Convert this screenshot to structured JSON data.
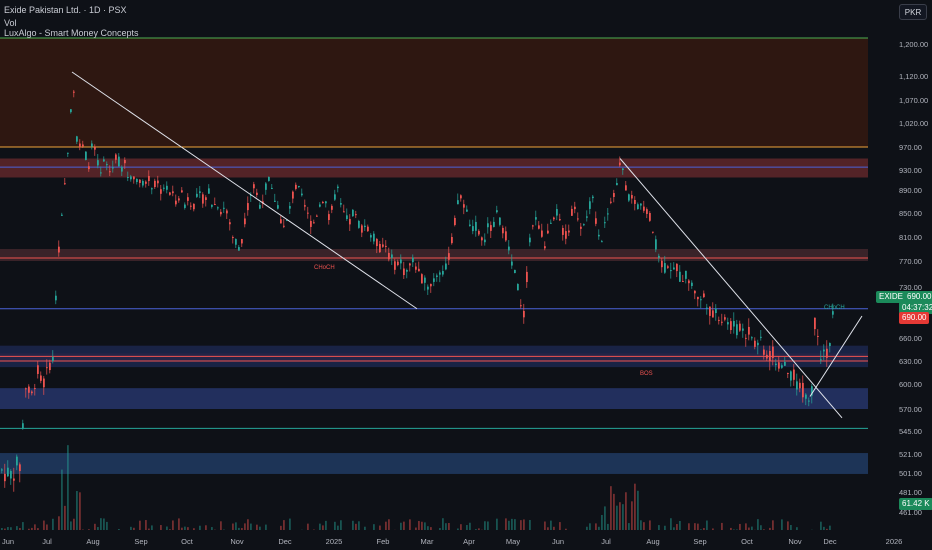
{
  "header": {
    "title": "Exide Pakistan Ltd. · 1D · PSX",
    "volume_label": "Vol",
    "indicator_label": "LuxAlgo - Smart Money Concepts"
  },
  "currency_button": "PKR",
  "price_badges": {
    "ticker": "EXIDE",
    "last_price": "690.00",
    "countdown": "04:37:32",
    "close_price": "690.00",
    "volume": "61.42 K"
  },
  "colors": {
    "background": "#0e1117",
    "up": "#26a69a",
    "down": "#ef5350",
    "trendline": "#e0e3eb",
    "resistance_line": "#f0a43a",
    "blue_line": "#4a62d8",
    "badge_green": "#1b8a5a",
    "badge_red": "#e53935"
  },
  "chart_data": {
    "type": "candlestick",
    "symbol": "EXIDE",
    "exchange": "PSX",
    "interval": "1D",
    "currency": "PKR",
    "price_axis": {
      "ylim": [
        452,
        1240
      ],
      "tick_labels": [
        "1,200.00",
        "1,120.00",
        "1,070.00",
        "1,020.00",
        "970.00",
        "930.00",
        "890.00",
        "850.00",
        "810.00",
        "770.00",
        "730.00",
        "690.00",
        "660.00",
        "630.00",
        "600.00",
        "570.00",
        "545.00",
        "521.00",
        "501.00",
        "481.00",
        "461.00"
      ]
    },
    "time_axis": {
      "tick_labels": [
        "Jun",
        "Jul",
        "Aug",
        "Sep",
        "Oct",
        "Nov",
        "Dec",
        "2025",
        "Feb",
        "Mar",
        "Apr",
        "May",
        "Jun",
        "Jul",
        "Aug",
        "Sep",
        "Oct",
        "Nov",
        "Dec",
        "2026"
      ]
    },
    "price_path": [
      [
        0,
        505
      ],
      [
        4,
        500
      ],
      [
        8,
        502
      ],
      [
        12,
        498
      ],
      [
        16,
        510
      ],
      [
        20,
        506
      ],
      [
        24,
        600
      ],
      [
        28,
        590
      ],
      [
        32,
        585
      ],
      [
        36,
        620
      ],
      [
        40,
        605
      ],
      [
        44,
        602
      ],
      [
        48,
        625
      ],
      [
        52,
        632
      ],
      [
        56,
        750
      ],
      [
        60,
        820
      ],
      [
        64,
        900
      ],
      [
        68,
        990
      ],
      [
        70,
        1050
      ],
      [
        72,
        1120
      ],
      [
        74,
        1060
      ],
      [
        76,
        990
      ],
      [
        80,
        975
      ],
      [
        84,
        960
      ],
      [
        88,
        940
      ],
      [
        92,
        980
      ],
      [
        96,
        945
      ],
      [
        100,
        920
      ],
      [
        104,
        950
      ],
      [
        108,
        925
      ],
      [
        112,
        935
      ],
      [
        116,
        960
      ],
      [
        120,
        930
      ],
      [
        124,
        940
      ],
      [
        128,
        910
      ],
      [
        132,
        925
      ],
      [
        136,
        905
      ],
      [
        140,
        915
      ],
      [
        144,
        900
      ],
      [
        148,
        910
      ],
      [
        152,
        895
      ],
      [
        156,
        905
      ],
      [
        160,
        890
      ],
      [
        164,
        900
      ],
      [
        168,
        885
      ],
      [
        172,
        880
      ],
      [
        176,
        870
      ],
      [
        180,
        890
      ],
      [
        184,
        865
      ],
      [
        188,
        880
      ],
      [
        192,
        860
      ],
      [
        196,
        875
      ],
      [
        200,
        880
      ],
      [
        204,
        870
      ],
      [
        208,
        890
      ],
      [
        212,
        860
      ],
      [
        216,
        870
      ],
      [
        220,
        855
      ],
      [
        224,
        860
      ],
      [
        228,
        840
      ],
      [
        232,
        810
      ],
      [
        236,
        800
      ],
      [
        240,
        790
      ],
      [
        244,
        840
      ],
      [
        248,
        870
      ],
      [
        252,
        900
      ],
      [
        256,
        880
      ],
      [
        260,
        860
      ],
      [
        264,
        890
      ],
      [
        268,
        910
      ],
      [
        272,
        880
      ],
      [
        276,
        870
      ],
      [
        280,
        840
      ],
      [
        284,
        820
      ],
      [
        288,
        850
      ],
      [
        292,
        880
      ],
      [
        296,
        900
      ],
      [
        300,
        880
      ],
      [
        304,
        860
      ],
      [
        308,
        840
      ],
      [
        312,
        830
      ],
      [
        316,
        850
      ],
      [
        320,
        870
      ],
      [
        324,
        880
      ],
      [
        328,
        840
      ],
      [
        332,
        860
      ],
      [
        336,
        900
      ],
      [
        340,
        860
      ],
      [
        344,
        845
      ],
      [
        348,
        830
      ],
      [
        352,
        850
      ],
      [
        356,
        840
      ],
      [
        360,
        825
      ],
      [
        364,
        830
      ],
      [
        368,
        820
      ],
      [
        372,
        810
      ],
      [
        376,
        800
      ],
      [
        380,
        790
      ],
      [
        384,
        800
      ],
      [
        388,
        780
      ],
      [
        392,
        770
      ],
      [
        396,
        760
      ],
      [
        400,
        770
      ],
      [
        404,
        750
      ],
      [
        408,
        760
      ],
      [
        412,
        770
      ],
      [
        416,
        760
      ],
      [
        420,
        740
      ],
      [
        424,
        745
      ],
      [
        428,
        730
      ],
      [
        432,
        740
      ],
      [
        436,
        750
      ],
      [
        440,
        760
      ],
      [
        444,
        750
      ],
      [
        448,
        780
      ],
      [
        452,
        810
      ],
      [
        456,
        860
      ],
      [
        460,
        880
      ],
      [
        464,
        860
      ],
      [
        468,
        840
      ],
      [
        472,
        820
      ],
      [
        476,
        830
      ],
      [
        480,
        800
      ],
      [
        484,
        810
      ],
      [
        488,
        830
      ],
      [
        492,
        820
      ],
      [
        496,
        850
      ],
      [
        500,
        830
      ],
      [
        504,
        820
      ],
      [
        508,
        790
      ],
      [
        512,
        760
      ],
      [
        516,
        740
      ],
      [
        520,
        700
      ],
      [
        524,
        690
      ],
      [
        528,
        800
      ],
      [
        532,
        830
      ],
      [
        536,
        840
      ],
      [
        540,
        820
      ],
      [
        544,
        800
      ],
      [
        548,
        820
      ],
      [
        552,
        830
      ],
      [
        556,
        850
      ],
      [
        560,
        830
      ],
      [
        564,
        810
      ],
      [
        568,
        820
      ],
      [
        572,
        860
      ],
      [
        576,
        850
      ],
      [
        580,
        830
      ],
      [
        584,
        840
      ],
      [
        588,
        860
      ],
      [
        592,
        870
      ],
      [
        596,
        820
      ],
      [
        600,
        800
      ],
      [
        604,
        840
      ],
      [
        608,
        860
      ],
      [
        612,
        880
      ],
      [
        616,
        900
      ],
      [
        620,
        950
      ],
      [
        624,
        900
      ],
      [
        628,
        880
      ],
      [
        632,
        870
      ],
      [
        636,
        860
      ],
      [
        640,
        870
      ],
      [
        644,
        860
      ],
      [
        648,
        850
      ],
      [
        652,
        820
      ],
      [
        656,
        790
      ],
      [
        660,
        770
      ],
      [
        664,
        760
      ],
      [
        668,
        770
      ],
      [
        672,
        750
      ],
      [
        676,
        760
      ],
      [
        680,
        740
      ],
      [
        684,
        750
      ],
      [
        688,
        740
      ],
      [
        692,
        730
      ],
      [
        696,
        720
      ],
      [
        700,
        710
      ],
      [
        704,
        720
      ],
      [
        708,
        700
      ],
      [
        712,
        690
      ],
      [
        716,
        700
      ],
      [
        720,
        685
      ],
      [
        724,
        690
      ],
      [
        728,
        675
      ],
      [
        732,
        680
      ],
      [
        736,
        670
      ],
      [
        740,
        680
      ],
      [
        744,
        665
      ],
      [
        748,
        670
      ],
      [
        752,
        660
      ],
      [
        756,
        650
      ],
      [
        760,
        660
      ],
      [
        764,
        640
      ],
      [
        768,
        635
      ],
      [
        772,
        640
      ],
      [
        776,
        625
      ],
      [
        780,
        630
      ],
      [
        784,
        620
      ],
      [
        788,
        610
      ],
      [
        792,
        615
      ],
      [
        796,
        600
      ],
      [
        800,
        595
      ],
      [
        804,
        590
      ],
      [
        808,
        580
      ],
      [
        812,
        600
      ],
      [
        814,
        680
      ],
      [
        816,
        690
      ],
      [
        818,
        650
      ],
      [
        820,
        640
      ],
      [
        822,
        660
      ],
      [
        824,
        630
      ],
      [
        826,
        640
      ],
      [
        828,
        650
      ],
      [
        830,
        660
      ],
      [
        832,
        690
      ]
    ],
    "horizontal_levels": [
      {
        "price": 1215,
        "color": "#4caf50"
      },
      {
        "price": 970,
        "color": "#f0a43a"
      },
      {
        "price": 935,
        "color": "#4a62d8"
      },
      {
        "price": 775,
        "color": "#ef5350"
      },
      {
        "price": 700,
        "color": "#4a62d8"
      },
      {
        "price": 636,
        "color": "#ef5350"
      },
      {
        "price": 630,
        "color": "#ef5350"
      },
      {
        "price": 548,
        "color": "#26a69a"
      }
    ],
    "zones": [
      {
        "from": 1215,
        "to": 970,
        "color": "#3a1a10"
      },
      {
        "from": 950,
        "to": 915,
        "color": "#6b2a2e"
      },
      {
        "from": 790,
        "to": 770,
        "color": "#4a2a30"
      },
      {
        "from": 640,
        "to": 630,
        "color": "#4a1d22"
      },
      {
        "from": 650,
        "to": 622,
        "color": "#1d2a55"
      },
      {
        "from": 595,
        "to": 570,
        "color": "#2a3a75"
      },
      {
        "from": 522,
        "to": 500,
        "color": "#23406e"
      }
    ],
    "labels": [
      {
        "text": "BOS",
        "x": 640,
        "price": 612,
        "color": "#ef5350"
      },
      {
        "text": "CHoCH",
        "x": 314,
        "price": 758,
        "color": "#ef5350"
      },
      {
        "text": "CHoCH",
        "x": 824,
        "price": 700,
        "color": "#26a69a"
      }
    ],
    "trendlines": [
      {
        "x1": 72,
        "p1": 1130,
        "x2": 417,
        "p2": 700
      },
      {
        "x1": 620,
        "p1": 950,
        "x2": 842,
        "p2": 560
      },
      {
        "x1": 810,
        "p1": 585,
        "x2": 862,
        "p2": 690
      }
    ]
  }
}
